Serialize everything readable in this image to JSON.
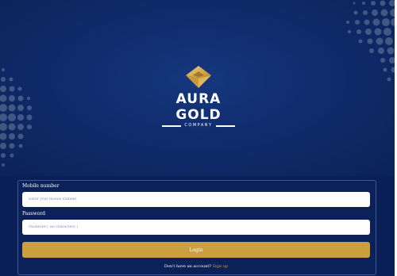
{
  "brand": {
    "name": "AURA GOLD",
    "tagline": "COMPANY"
  },
  "form": {
    "mobile_label": "Mobile number",
    "mobile_placeholder": "Enter your mobile number",
    "password_label": "Password",
    "password_placeholder": "Password ( ≥6 characters )",
    "login_label": "Login",
    "signup_prompt": "Don't have an account?",
    "signup_link": "Sign up"
  },
  "colors": {
    "background": "#0a2156",
    "gold_accent": "#c9a03b",
    "panel_border": "#3b5a9e"
  },
  "icons": {
    "logo": "gold-diamond-emblem",
    "decor": "halftone-dots"
  }
}
